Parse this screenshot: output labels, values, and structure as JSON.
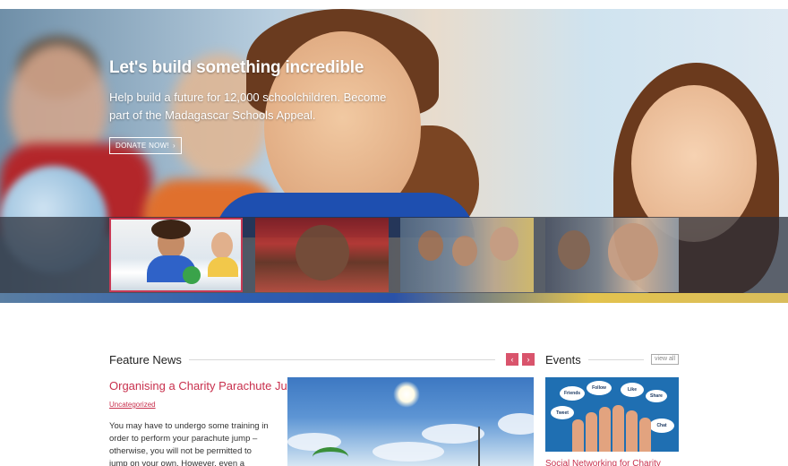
{
  "hero": {
    "title": "Let's build something incredible",
    "subtitle": "Help build a future for 12,000 schoolchildren. Become part of the Madagascar Schools Appeal.",
    "button_label": "DONATE NOW!",
    "button_icon": "chevron-right-icon"
  },
  "thumbnails": [
    {
      "alt": "children-in-classroom",
      "active": true
    },
    {
      "alt": "woman-with-bindi",
      "active": false
    },
    {
      "alt": "group-of-children",
      "active": false
    },
    {
      "alt": "toddler-close-up",
      "active": false
    }
  ],
  "feature_news": {
    "heading": "Feature News",
    "prev_icon": "chevron-left-icon",
    "next_icon": "chevron-right-icon",
    "prev_label": "‹",
    "next_label": "›",
    "article": {
      "title": "Organising a Charity Parachute Jump",
      "category": "Uncategorized",
      "excerpt": "You may have to undergo some training in order to perform your parachute jump – otherwise, you will not be permitted to jump on your own. However, even a tandem jump with a licensed"
    }
  },
  "events": {
    "heading": "Events",
    "view_all_label": "view all",
    "image_bubbles": [
      "Friends",
      "Follow",
      "Like",
      "Tweet",
      "Chat",
      "Share"
    ],
    "event_title": "Social Networking for Charity"
  },
  "colors": {
    "accent": "#c8304d",
    "arrow_button": "#d9546c",
    "thumb_border": "#c83a56"
  }
}
